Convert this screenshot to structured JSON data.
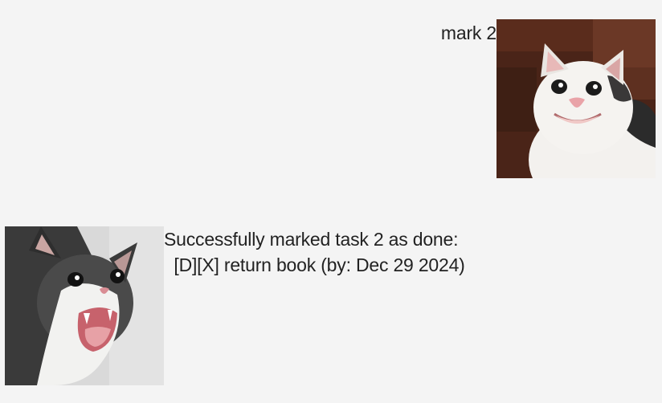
{
  "dialog": [
    {
      "speaker": "user",
      "text": "mark 2",
      "avatar": "smiling-white-cat-avatar"
    },
    {
      "speaker": "bot",
      "text": "Successfully marked task 2 as done:\n  [D][X] return book (by: Dec 29 2024)",
      "avatar": "screaming-cat-avatar"
    }
  ],
  "colors": {
    "background": "#f4f4f4",
    "text": "#222222"
  }
}
